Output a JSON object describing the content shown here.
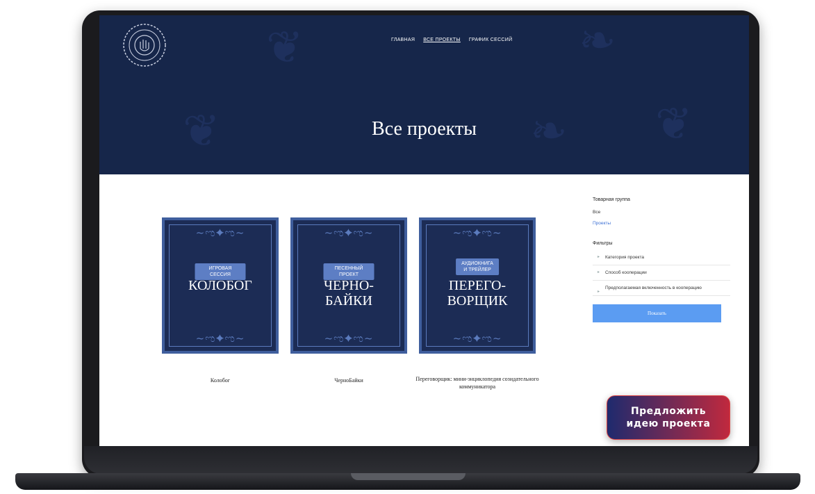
{
  "nav": {
    "items": [
      {
        "label": "ГЛАВНАЯ"
      },
      {
        "label": "ВСЕ ПРОЕКТЫ"
      },
      {
        "label": "ГРАФИК СЕССИЙ"
      }
    ]
  },
  "hero": {
    "title": "Все проекты"
  },
  "projects": [
    {
      "badge": "ИГРОВАЯ СЕССИЯ",
      "title": "КОЛОБОГ",
      "caption": "Колобог"
    },
    {
      "badge": "ПЕСЕННЫЙ ПРОЕКТ",
      "title": "ЧЕРНО-\nБАЙКИ",
      "caption": "ЧерноБайки"
    },
    {
      "badge": "АУДИОКНИГА\nИ ТРЕЙЛЕР",
      "title": "ПЕРЕГО-\nВОРЩИК",
      "caption": "Переговорщик: мини-энциклопедия созидательного коммуникатора"
    }
  ],
  "sidebar": {
    "group_heading": "Товарная группа",
    "group_items": [
      "Все",
      "Проекты"
    ],
    "filters_heading": "Фильтры",
    "filters": [
      "Категория проекта",
      "Способ кооперации",
      "Предполагаемая включенность в кооперацию"
    ],
    "show_button": "Показать"
  },
  "cta": {
    "label": "Предложить\nидею проекта"
  },
  "colors": {
    "hero_bg": "#16264a",
    "card_bg": "#1c2c55",
    "accent_blue": "#5b9cf2",
    "cta_red": "#c0293e"
  }
}
